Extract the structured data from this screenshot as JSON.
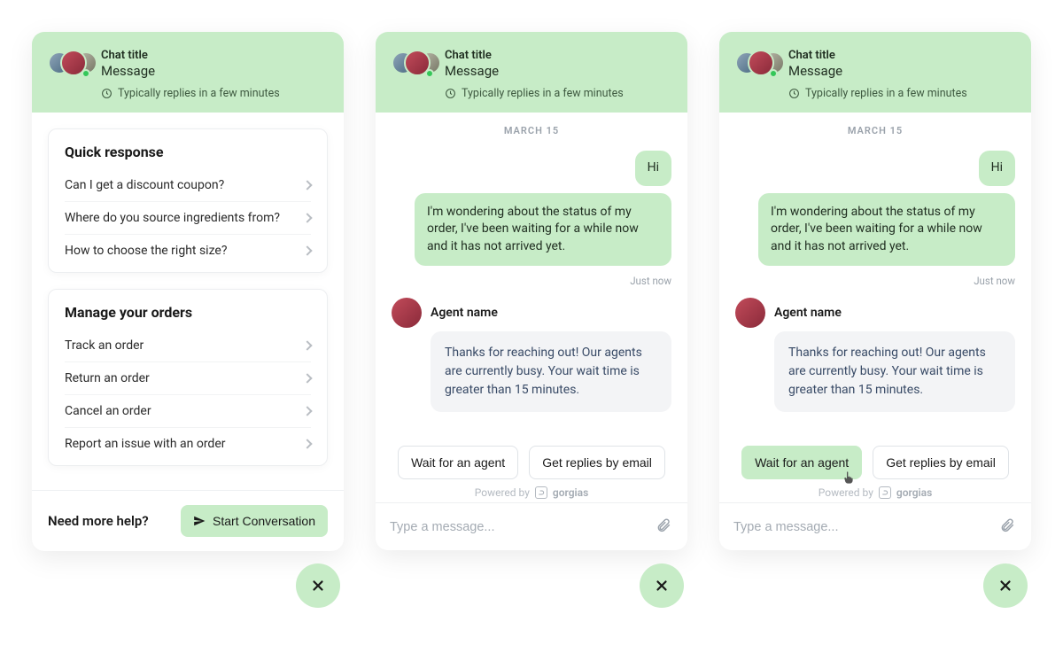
{
  "header": {
    "title": "Chat title",
    "subtitle": "Message",
    "reply_info": "Typically replies in a few minutes"
  },
  "panel1": {
    "quick_response_title": "Quick response",
    "quick_items": [
      {
        "label": "Can I get a discount coupon?"
      },
      {
        "label": "Where do you source ingredients from?"
      },
      {
        "label": "How to choose the right size?"
      }
    ],
    "orders_title": "Manage your orders",
    "order_items": [
      {
        "label": "Track an order"
      },
      {
        "label": "Return an order"
      },
      {
        "label": "Cancel an order"
      },
      {
        "label": "Report an issue with an order"
      }
    ],
    "footer_text": "Need more help?",
    "start_btn": "Start Conversation"
  },
  "chat": {
    "date_label": "MARCH 15",
    "user_msg1": "Hi",
    "user_msg2": "I'm wondering about the status of my order, I've been waiting for a while now and it has not arrived yet.",
    "timestamp": "Just now",
    "agent_name": "Agent name",
    "agent_msg": "Thanks for reaching out! Our agents are currently busy. Your wait time is greater than 15 minutes.",
    "wait_btn": "Wait for an agent",
    "email_btn": "Get replies by email",
    "powered_by": "Powered by",
    "brand": "gorgias",
    "input_placeholder": "Type a message..."
  }
}
